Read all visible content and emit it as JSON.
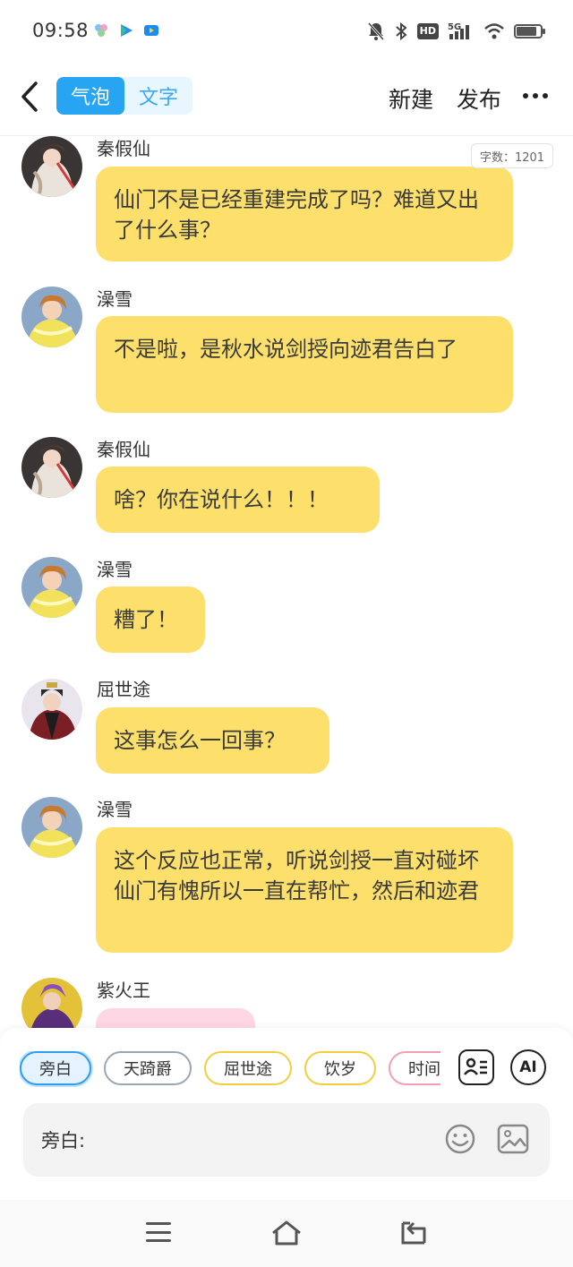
{
  "status_bar": {
    "time": "09:58",
    "network": "5G",
    "hd": "HD",
    "battery_level": 0.85
  },
  "nav": {
    "tabs": [
      {
        "label": "气泡",
        "active": true
      },
      {
        "label": "文字",
        "active": false
      }
    ],
    "new_label": "新建",
    "publish_label": "发布"
  },
  "word_count": "字数：1201",
  "messages": [
    {
      "name": "秦假仙",
      "text": "仙门不是已经重建完成了吗？难道又出了什么事？",
      "avatar": "qin-jiaxian"
    },
    {
      "name": "澡雪",
      "text": "不是啦，是秋水说剑授向迹君告白了",
      "avatar": "zaoxue"
    },
    {
      "name": "秦假仙",
      "text": "啥？你在说什么！！！",
      "avatar": "qin-jiaxian"
    },
    {
      "name": "澡雪",
      "text": "糟了！",
      "avatar": "zaoxue"
    },
    {
      "name": "屈世途",
      "text": "这事怎么一回事？",
      "avatar": "qu-shitu"
    },
    {
      "name": "澡雪",
      "text": "这个反应也正常，听说剑授一直对碰坏仙门有愧所以一直在帮忙，然后和迹君",
      "avatar": "zaoxue"
    },
    {
      "name": "紫火王",
      "text": "",
      "avatar": "zihuo-wang"
    }
  ],
  "roles": [
    "旁白",
    "天踦爵",
    "屈世途",
    "饮岁",
    "时间城"
  ],
  "tools": {
    "ai_label": "AI"
  },
  "input": {
    "label": "旁白:"
  },
  "colors": {
    "accent": "#27a5f2",
    "bubble_yellow": "#fde06b",
    "bubble_pink": "#ffd7e2"
  }
}
